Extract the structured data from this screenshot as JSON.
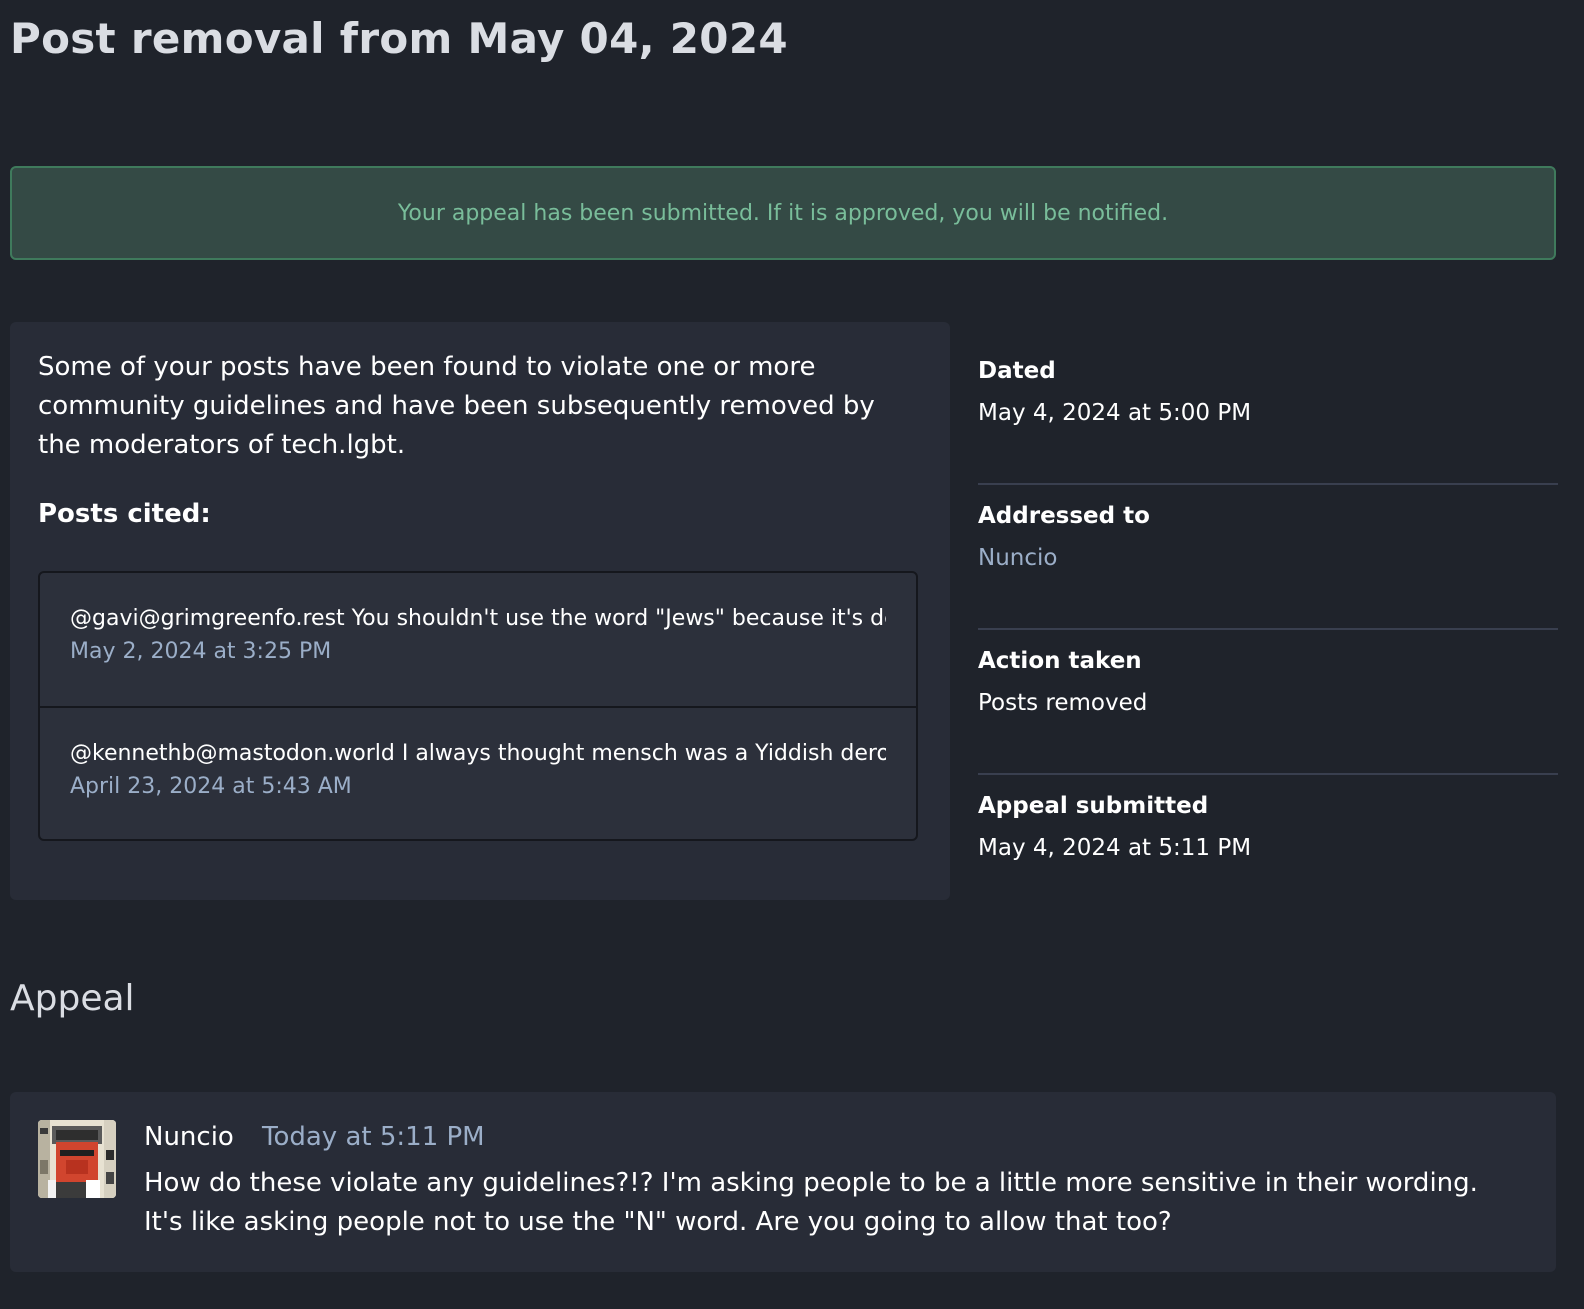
{
  "page": {
    "title": "Post removal from May 04, 2024"
  },
  "flash": {
    "message": "Your appeal has been submitted. If it is approved, you will be notified."
  },
  "report": {
    "intro": "Some of your posts have been found to violate one or more community guidelines and have been subsequently removed by the moderators of tech.lgbt.",
    "posts_cited_label": "Posts cited:",
    "posts": [
      {
        "text": "@gavi@grimgreenfo.rest You shouldn't use the word \"Jews\" because it's de",
        "date": "May 2, 2024 at 3:25 PM"
      },
      {
        "text": "@kennethb@mastodon.world I always thought mensch was a Yiddish dero",
        "date": "April 23, 2024 at 5:43 AM"
      }
    ]
  },
  "meta": {
    "dated": {
      "label": "Dated",
      "value": "May 4, 2024 at 5:00 PM"
    },
    "addressed_to": {
      "label": "Addressed to",
      "value": "Nuncio"
    },
    "action_taken": {
      "label": "Action taken",
      "value": "Posts removed"
    },
    "appeal_submitted": {
      "label": "Appeal submitted",
      "value": "May 4, 2024 at 5:11 PM"
    }
  },
  "appeal": {
    "heading": "Appeal",
    "author": "Nuncio",
    "time": "Today at 5:11 PM",
    "text": "How do these violate any guidelines?!? I'm asking people to be a little more sensitive in their wording. It's like asking people not to use the \"N\" word. Are you going to allow that too?"
  },
  "colors": {
    "background": "#1f232b",
    "card": "#282c37",
    "accent_link": "#9baec8",
    "success_text": "#79bd9a",
    "success_bg": "#344a45",
    "success_border": "#3f7a5c"
  }
}
